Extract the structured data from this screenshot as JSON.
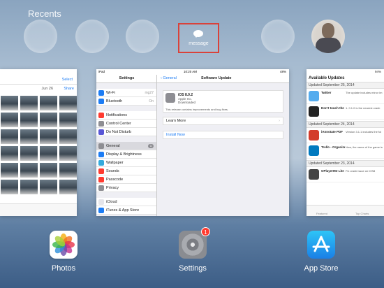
{
  "header": {
    "title": "Recents"
  },
  "contacts": {
    "highlighted_label": "message"
  },
  "photos_card": {
    "select_label": "Select",
    "date": "Jun 26",
    "share_label": "Share",
    "thumb_count": 24
  },
  "settings_card": {
    "status_left": "iPad",
    "status_time": "10:20 AM",
    "status_right": "48%",
    "nav_title": "Settings",
    "back_label": "General",
    "detail_title": "Software Update",
    "list_group1": [
      {
        "label": "Wi-Fi",
        "value": "mg27",
        "icon_color": "#1c7cf4"
      },
      {
        "label": "Bluetooth",
        "value": "On",
        "icon_color": "#1c7cf4"
      }
    ],
    "list_group2": [
      {
        "label": "Notifications",
        "icon_color": "#ff3b30"
      },
      {
        "label": "Control Center",
        "icon_color": "#8e8e93"
      },
      {
        "label": "Do Not Disturb",
        "icon_color": "#5856d6"
      }
    ],
    "list_group3": [
      {
        "label": "General",
        "icon_color": "#8e8e93",
        "badge": "1"
      },
      {
        "label": "Display & Brightness",
        "icon_color": "#1c7cf4"
      },
      {
        "label": "Wallpaper",
        "icon_color": "#34aadc"
      },
      {
        "label": "Sounds",
        "icon_color": "#ff3b30"
      },
      {
        "label": "Passcode",
        "icon_color": "#ff3b30"
      },
      {
        "label": "Privacy",
        "icon_color": "#8e8e93"
      }
    ],
    "list_group4": [
      {
        "label": "iCloud",
        "icon_color": "#e5e5ea"
      },
      {
        "label": "iTunes & App Store",
        "icon_color": "#1c7cf4"
      }
    ],
    "update": {
      "name": "iOS 8.0.2",
      "company": "Apple Inc.",
      "status": "Downloaded",
      "note": "This release contains improvements and bug fixes.",
      "learn_more": "Learn More",
      "learn_more_chevron": "›",
      "install_now": "Install Now"
    }
  },
  "appstore_card": {
    "status_right": "94%",
    "heading": "Available Updates",
    "sections": [
      {
        "title": "Updated September 25, 2014",
        "items": [
          {
            "name": "Twitter",
            "desc": "The update includes minor im",
            "icon_color": "#55acee"
          },
          {
            "name": "Don't touch the white tile",
            "desc": "1. 0.1.0 is the nearest crash",
            "icon_color": "#222222"
          }
        ]
      },
      {
        "title": "Updated September 24, 2014",
        "items": [
          {
            "name": "iAnnotate PDF",
            "desc": "Version 3.1.1 includes the fol",
            "icon_color": "#d33c2b"
          },
          {
            "name": "Trello - Organize Anything",
            "desc": "Now, the name of the game is",
            "icon_color": "#0079bf"
          }
        ]
      },
      {
        "title": "Updated September 23, 2014",
        "items": [
          {
            "name": "OPlayerHD Lite",
            "desc": "Fix crash issue on iOS8",
            "icon_color": "#444444"
          }
        ]
      }
    ],
    "tabs": [
      "Featured",
      "Top Charts"
    ]
  },
  "dock": [
    {
      "label": "Photos"
    },
    {
      "label": "Settings",
      "badge": "1"
    },
    {
      "label": "App Store"
    }
  ]
}
